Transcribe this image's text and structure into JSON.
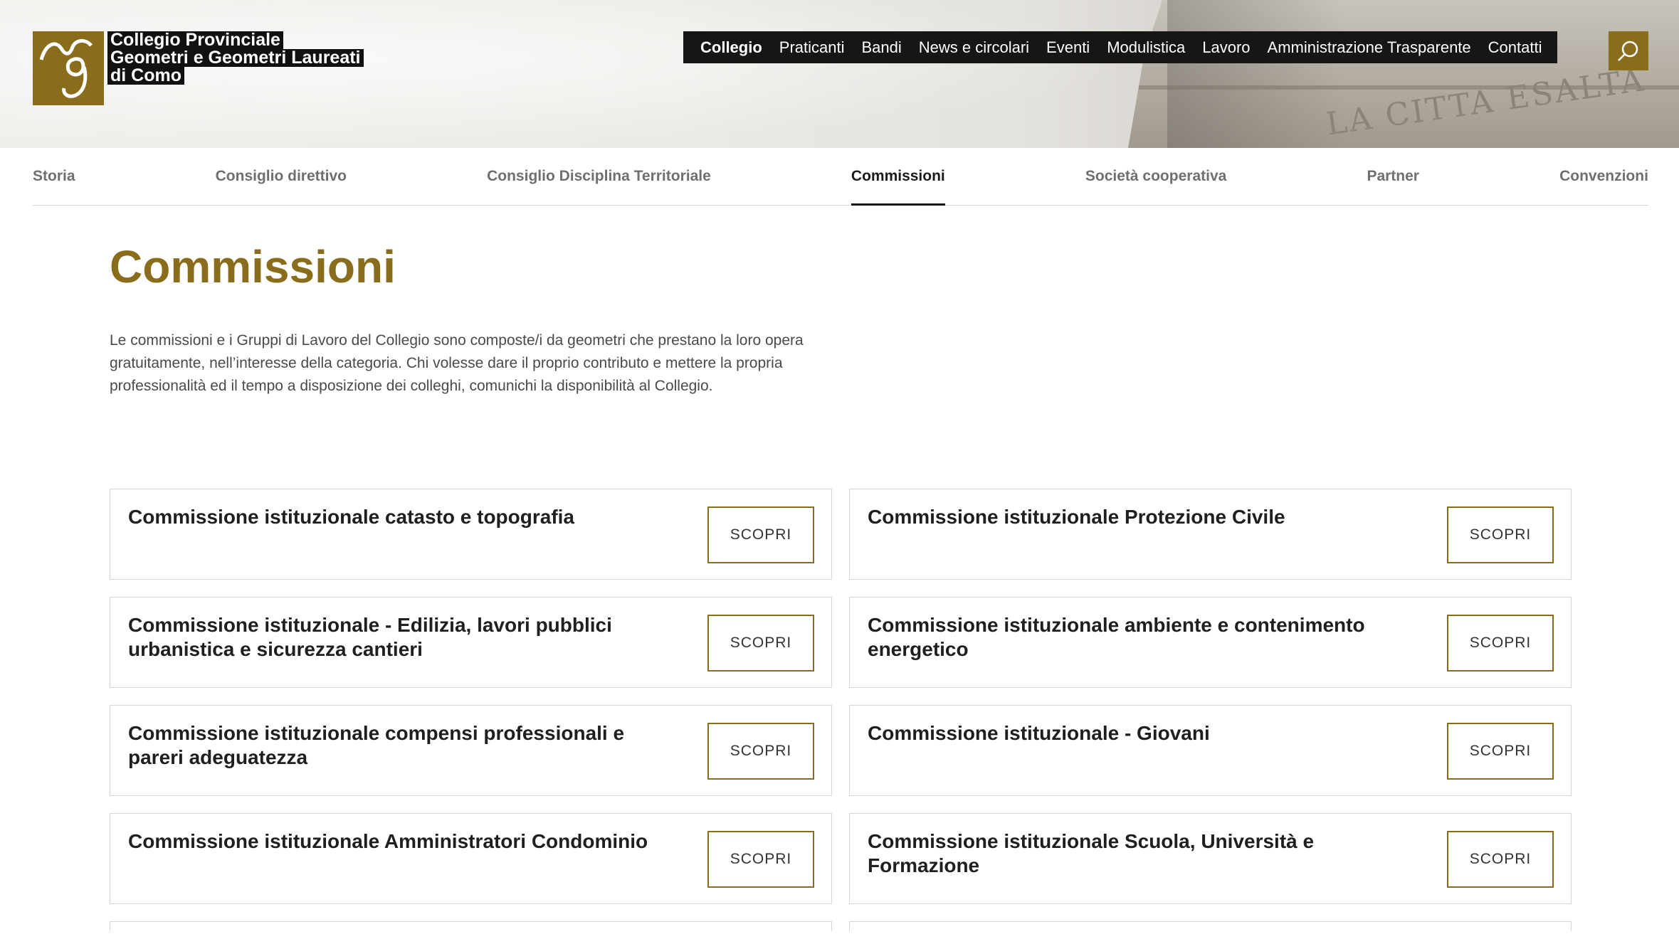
{
  "header": {
    "logo_lines": [
      "Collegio Provinciale",
      "Geometri e Geometri Laureati",
      "di Como"
    ],
    "monument_inscription": "LA CITTA ESALTA",
    "nav": [
      {
        "label": "Collegio",
        "active": true
      },
      {
        "label": "Praticanti",
        "active": false
      },
      {
        "label": "Bandi",
        "active": false
      },
      {
        "label": "News e circolari",
        "active": false
      },
      {
        "label": "Eventi",
        "active": false
      },
      {
        "label": "Modulistica",
        "active": false
      },
      {
        "label": "Lavoro",
        "active": false
      },
      {
        "label": "Amministrazione Trasparente",
        "active": false
      },
      {
        "label": "Contatti",
        "active": false
      }
    ],
    "search_icon": "search-icon"
  },
  "subnav": [
    {
      "label": "Storia",
      "active": false
    },
    {
      "label": "Consiglio direttivo",
      "active": false
    },
    {
      "label": "Consiglio Disciplina Territoriale",
      "active": false
    },
    {
      "label": "Commissioni",
      "active": true
    },
    {
      "label": "Società cooperativa",
      "active": false
    },
    {
      "label": "Partner",
      "active": false
    },
    {
      "label": "Convenzioni",
      "active": false
    }
  ],
  "main": {
    "title": "Commissioni",
    "intro": "Le commissioni e i Gruppi di Lavoro del Collegio sono composte/i da geometri che prestano la loro opera gratuitamente, nell’interesse della categoria. Chi volesse dare il proprio contributo e mettere la propria professionalità ed il tempo a disposizione dei colleghi, comunichi la disponibilità al Collegio.",
    "button_label": "SCOPRI",
    "cards": [
      {
        "title": "Commissione istituzionale catasto e topografia"
      },
      {
        "title": "Commissione istituzionale Protezione Civile"
      },
      {
        "title": "Commissione istituzionale - Edilizia, lavori pubblici urbanistica e sicurezza cantieri"
      },
      {
        "title": "Commissione istituzionale ambiente e contenimento energetico"
      },
      {
        "title": "Commissione istituzionale compensi professionali e pareri adeguatezza"
      },
      {
        "title": "Commissione istituzionale - Giovani"
      },
      {
        "title": "Commissione istituzionale Amministratori Condominio"
      },
      {
        "title": "Commissione istituzionale Scuola, Università e Formazione"
      }
    ]
  },
  "colors": {
    "accent": "#8a6d1c",
    "nav_bg": "#161616",
    "text": "#1f1f1f"
  }
}
